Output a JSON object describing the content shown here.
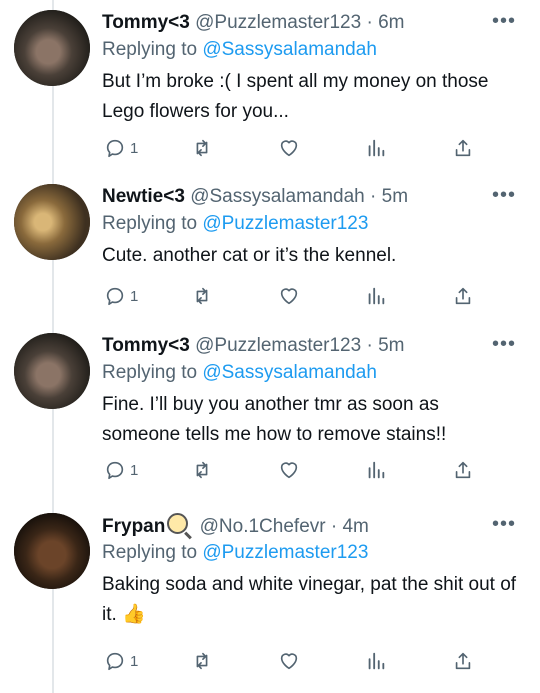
{
  "tweets": [
    {
      "name": "Tommy<3",
      "handle": "@Puzzlemaster123",
      "time": "6m",
      "replying_prefix": "Replying to",
      "replying_to": "@Sassysalamandah",
      "text": "But I’m broke :( I spent all my money on those Lego flowers for you...",
      "reply_count": "1",
      "avatar_icon": "avatar-dark-hair",
      "emoji": ""
    },
    {
      "name": "Newtie<3",
      "handle": "@Sassysalamandah",
      "time": "5m",
      "replying_prefix": "Replying to",
      "replying_to": "@Puzzlemaster123",
      "text": "Cute. another cat or it’s the kennel.",
      "reply_count": "1",
      "avatar_icon": "avatar-blond-hair",
      "emoji": ""
    },
    {
      "name": "Tommy<3",
      "handle": "@Puzzlemaster123",
      "time": "5m",
      "replying_prefix": "Replying to",
      "replying_to": "@Sassysalamandah",
      "text": "Fine. I’ll buy you another tmr as soon as someone tells me how to remove stains!!",
      "reply_count": "1",
      "avatar_icon": "avatar-dark-hair",
      "emoji": ""
    },
    {
      "name": "Frypan",
      "handle": "@No.1Chefevr",
      "time": "4m",
      "replying_prefix": "Replying to",
      "replying_to": "@Puzzlemaster123",
      "text": "Baking soda and white vinegar, pat the shit out of it.",
      "reply_count": "1",
      "avatar_icon": "avatar-smiling",
      "emoji": "👍"
    }
  ],
  "separator": "·",
  "more_label": "•••",
  "icons": [
    "reply-icon",
    "retweet-icon",
    "like-icon",
    "analytics-icon",
    "share-icon",
    "more-icon",
    "frying-pan-icon"
  ],
  "colors": {
    "link": "#1d9bf0",
    "muted": "#536471",
    "text": "#0f1419"
  }
}
